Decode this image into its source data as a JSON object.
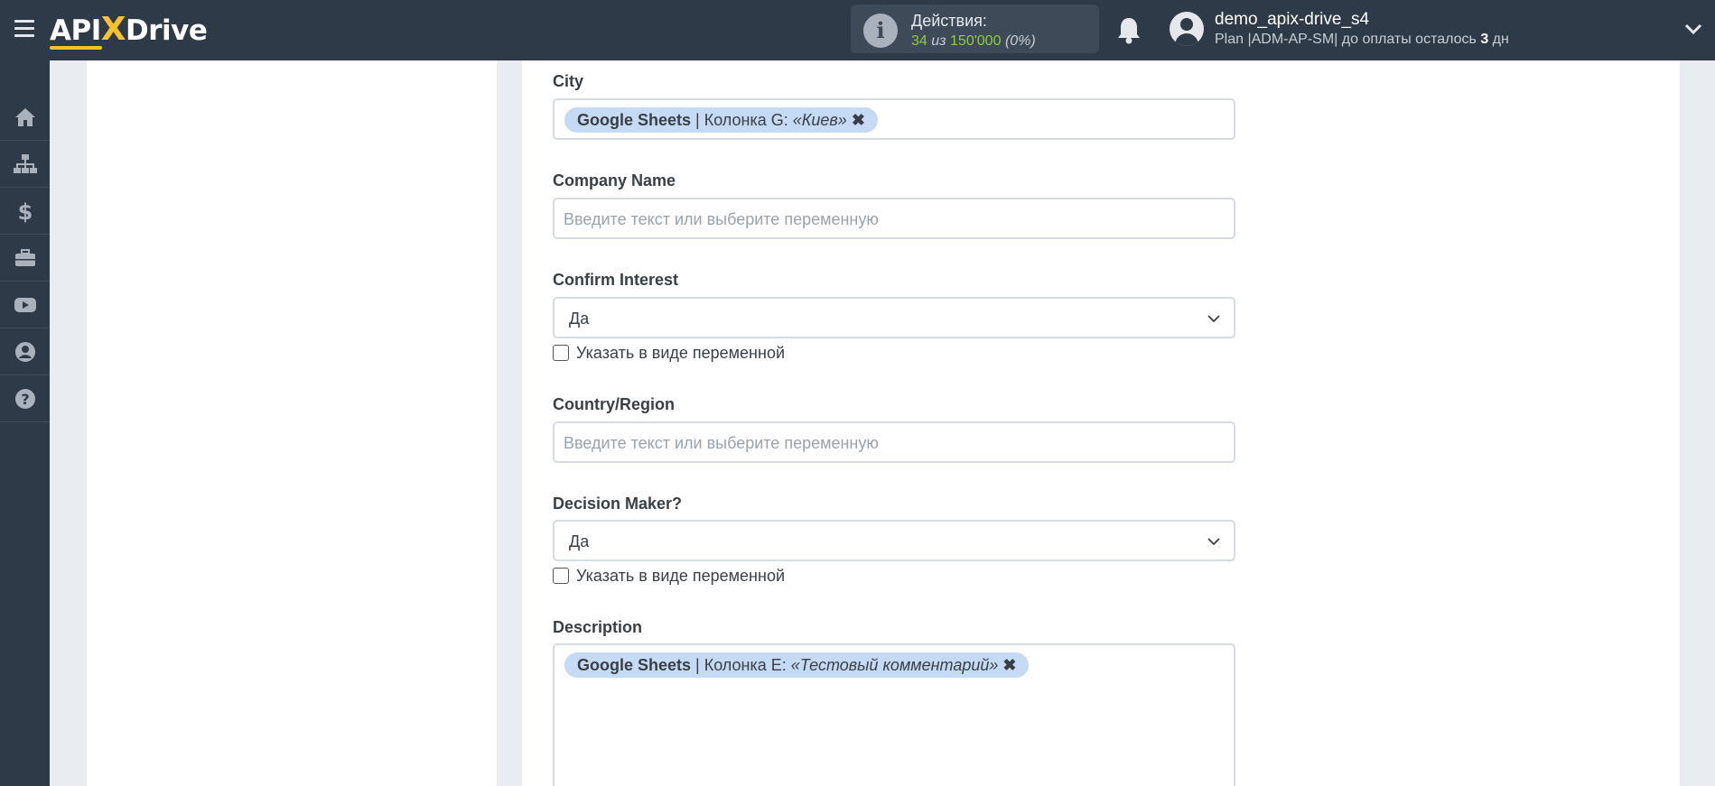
{
  "header": {
    "logo": {
      "part1": "API",
      "x": "X",
      "part2": "Drive"
    },
    "actions": {
      "label": "Действия:",
      "used": "34",
      "separator": " из ",
      "total": "150'000",
      "percent": "(0%)"
    },
    "user": {
      "name": "demo_apix-drive_s4",
      "plan_prefix": "Plan |ADM-AP-SM| до оплаты осталось ",
      "days": "3",
      "days_suffix": " дн"
    }
  },
  "sidebar": {
    "items": [
      {
        "icon": "home-icon"
      },
      {
        "icon": "sitemap-icon"
      },
      {
        "icon": "dollar-icon"
      },
      {
        "icon": "briefcase-icon"
      },
      {
        "icon": "youtube-icon"
      },
      {
        "icon": "user-circle-icon"
      },
      {
        "icon": "question-icon"
      }
    ]
  },
  "form": {
    "city": {
      "label": "City",
      "tag": {
        "source": "Google Sheets",
        "column": " | Колонка G: ",
        "value": "«Киев»",
        "remove": "✖"
      }
    },
    "company_name": {
      "label": "Company Name",
      "placeholder": "Введите текст или выберите переменную"
    },
    "confirm_interest": {
      "label": "Confirm Interest",
      "value": "Да",
      "checkbox_label": "Указать в виде переменной"
    },
    "country_region": {
      "label": "Country/Region",
      "placeholder": "Введите текст или выберите переменную"
    },
    "decision_maker": {
      "label": "Decision Maker?",
      "value": "Да",
      "checkbox_label": "Указать в виде переменной"
    },
    "description": {
      "label": "Description",
      "tag": {
        "source": "Google Sheets",
        "column": " | Колонка E: ",
        "value": "«Тестовый комментарий»",
        "remove": "✖"
      }
    }
  },
  "colors": {
    "header_bg": "#2e3a48",
    "accent_yellow": "#f4c22b",
    "actions_green": "#8fcc3c",
    "tag_bg": "#c5dbf5"
  }
}
